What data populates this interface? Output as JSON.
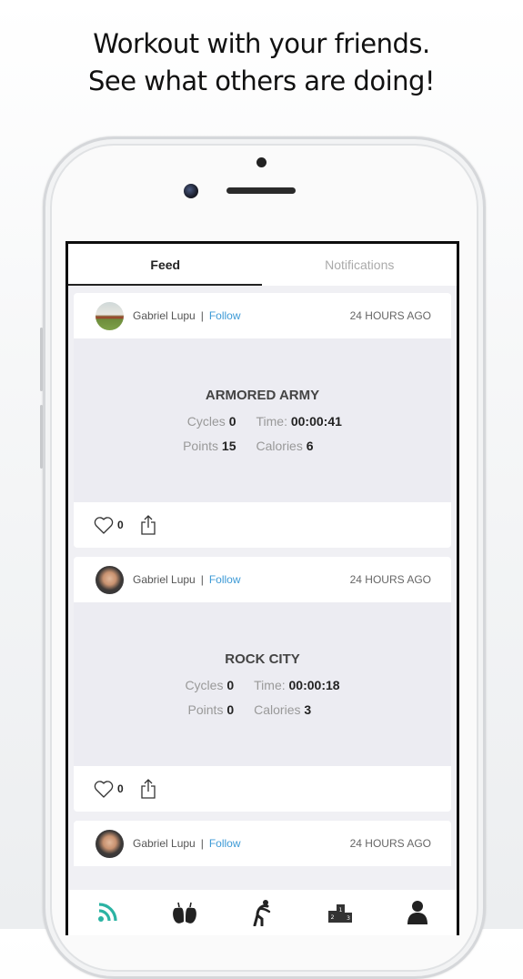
{
  "headline": {
    "line1": "Workout with your friends.",
    "line2": "See what others are doing!"
  },
  "tabs": [
    {
      "label": "Feed",
      "active": true
    },
    {
      "label": "Notifications",
      "active": false
    }
  ],
  "feed": [
    {
      "user": "Gabriel Lupu",
      "separator": "|",
      "follow_label": "Follow",
      "time_ago": "24 HOURS AGO",
      "workout": "ARMORED ARMY",
      "stats": {
        "cycles_label": "Cycles",
        "cycles": "0",
        "time_label": "Time:",
        "time": "00:00:41",
        "points_label": "Points",
        "points": "15",
        "calories_label": "Calories",
        "calories": "6"
      },
      "likes": "0"
    },
    {
      "user": "Gabriel Lupu",
      "separator": "|",
      "follow_label": "Follow",
      "time_ago": "24 HOURS AGO",
      "workout": "ROCK CITY",
      "stats": {
        "cycles_label": "Cycles",
        "cycles": "0",
        "time_label": "Time:",
        "time": "00:00:18",
        "points_label": "Points",
        "points": "0",
        "calories_label": "Calories",
        "calories": "3"
      },
      "likes": "0"
    },
    {
      "user": "Gabriel Lupu",
      "separator": "|",
      "follow_label": "Follow",
      "time_ago": "24 HOURS AGO"
    }
  ],
  "bottom_nav": [
    {
      "icon": "feed-icon",
      "active": true
    },
    {
      "icon": "nutrition-icon",
      "active": false
    },
    {
      "icon": "exercise-icon",
      "active": false
    },
    {
      "icon": "leaderboard-icon",
      "active": false
    },
    {
      "icon": "profile-icon",
      "active": false
    }
  ],
  "colors": {
    "accent": "#2bb3a3",
    "link": "#3d9ad6",
    "card_body": "#ececf2"
  }
}
